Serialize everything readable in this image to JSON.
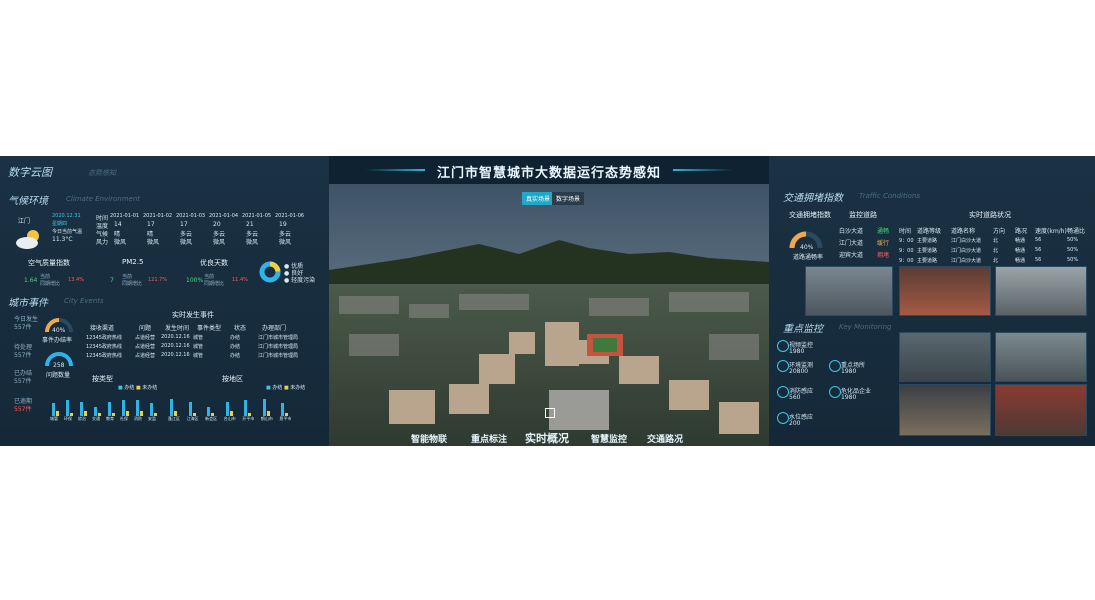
{
  "left": {
    "title": "数字云图",
    "title_sub": "态势感知",
    "climate": {
      "title": "气候环境",
      "title_en": "Climate Environment",
      "city": "江门",
      "date": "2020.12.31",
      "weekday": "星期四",
      "today_label": "今日当前气温",
      "temp": "11.3°C",
      "days": [
        "2021-01-01",
        "2021-01-02",
        "2021-01-03",
        "2021-01-04",
        "2021-01-05",
        "2021-01-06"
      ],
      "row_labels": [
        "时间",
        "温度",
        "气候",
        "风力"
      ],
      "temps": [
        "14",
        "17",
        "17",
        "20",
        "21",
        "19"
      ],
      "weather": [
        "晴",
        "晴",
        "多云",
        "多云",
        "多云",
        "多云"
      ],
      "wind": [
        "微风",
        "微风",
        "微风",
        "微风",
        "微风",
        "微风"
      ],
      "aqi": {
        "title": "空气质量指数",
        "value": "1.64",
        "label1": "当前",
        "label2": "同期增比",
        "change": "13.4%"
      },
      "pm25": {
        "title": "PM2.5",
        "value": "7",
        "label1": "当前",
        "label2": "同期增比",
        "change": "121.7%"
      },
      "good_days": {
        "title": "优良天数",
        "value": "100%",
        "label1": "当前",
        "label2": "同期增比",
        "change": "11.4%"
      },
      "legend": [
        "优质",
        "良好",
        "轻度污染"
      ]
    },
    "events": {
      "title": "城市事件",
      "title_en": "City Events",
      "stats": [
        {
          "label": "今日发生",
          "value": "557件"
        },
        {
          "label": "待处理",
          "value": "557件"
        },
        {
          "label": "已办结",
          "value": "557件"
        },
        {
          "label": "已逾期",
          "value": "557件"
        }
      ],
      "gauge1": {
        "value": "40%",
        "label": "事件办结率"
      },
      "gauge2": {
        "value": "258",
        "label": "问题数量"
      },
      "realtime_title": "实时发生事件",
      "headers": [
        "接收渠道",
        "问题",
        "发生时间",
        "事件类型",
        "状态",
        "办理部门"
      ],
      "rows": [
        [
          "12345政府热线",
          "占道经营",
          "2020.12.16",
          "城管",
          "办结",
          "江门市城市管理局"
        ],
        [
          "12345政府热线",
          "占道经营",
          "2020.12.16",
          "城管",
          "办结",
          "江门市城市管理局"
        ],
        [
          "12345政府热线",
          "占道经营",
          "2020.12.16",
          "城管",
          "办结",
          "江门市城市管理局"
        ]
      ],
      "by_type": {
        "title": "按类型",
        "legend": [
          "办结",
          "未办结"
        ],
        "categories": [
          "城管",
          "环保",
          "综治",
          "交通",
          "教育",
          "社保",
          "消防",
          "安监"
        ],
        "done": [
          8,
          10,
          9,
          6,
          9,
          10,
          10,
          8
        ],
        "undone": [
          3,
          2,
          3,
          2,
          2,
          3,
          3,
          2
        ]
      },
      "by_area": {
        "title": "按地区",
        "legend": [
          "办结",
          "未办结"
        ],
        "categories": [
          "蓬江区",
          "江海区",
          "新会区",
          "台山市",
          "开平市",
          "鹤山市",
          "恩平市"
        ],
        "done": [
          11,
          9,
          6,
          9,
          10,
          11,
          8
        ],
        "undone": [
          3,
          2,
          2,
          3,
          2,
          3,
          2
        ]
      }
    }
  },
  "center": {
    "title": "江门市智慧城市大数据运行态势感知",
    "scene_buttons": [
      "真实场景",
      "数字场景"
    ],
    "nav": [
      "智能物联",
      "重点标注",
      "实时概况",
      "智慧监控",
      "交通路况"
    ],
    "colors": {
      "accent": "#1fb6d6",
      "title": "#e9f6ff"
    }
  },
  "right": {
    "traffic": {
      "title": "交通拥堵指数",
      "title_en": "Traffic Conditions",
      "col1": "交通拥堵指数",
      "col2": "监控道路",
      "col3": "实时道路状况",
      "gauge": {
        "value": "40%",
        "label": "道路通畅率"
      },
      "roads": [
        {
          "name": "白沙大道",
          "status": "通畅"
        },
        {
          "name": "江门大道",
          "status": "缓行"
        },
        {
          "name": "迎宾大道",
          "status": "拥堵"
        }
      ],
      "headers": [
        "时间",
        "道路等级",
        "道路名称",
        "方向",
        "路况",
        "速度(km/h)",
        "畅通比"
      ],
      "rows": [
        [
          "9：00",
          "主要道路",
          "江门白沙大道",
          "北",
          "畅通",
          "56",
          "50%"
        ],
        [
          "9：00",
          "主要道路",
          "江门白沙大道",
          "北",
          "畅通",
          "56",
          "50%"
        ],
        [
          "9：00",
          "主要道路",
          "江门白沙大道",
          "北",
          "畅通",
          "56",
          "50%"
        ]
      ]
    },
    "monitor": {
      "title": "重点监控",
      "title_en": "Key Monitoring",
      "items": [
        {
          "label": "视频监控",
          "value": "1980",
          "icon": "camera-icon"
        },
        {
          "label": "环境监测",
          "value": "20800",
          "icon": "leaf-icon"
        },
        {
          "label": "重点场所",
          "value": "1980",
          "icon": "building-icon"
        },
        {
          "label": "消防感应",
          "value": "560",
          "icon": "fire-icon"
        },
        {
          "label": "危化品企业",
          "value": "1980",
          "icon": "warning-icon"
        },
        {
          "label": "水位感应",
          "value": "200",
          "icon": "water-icon"
        }
      ]
    }
  }
}
